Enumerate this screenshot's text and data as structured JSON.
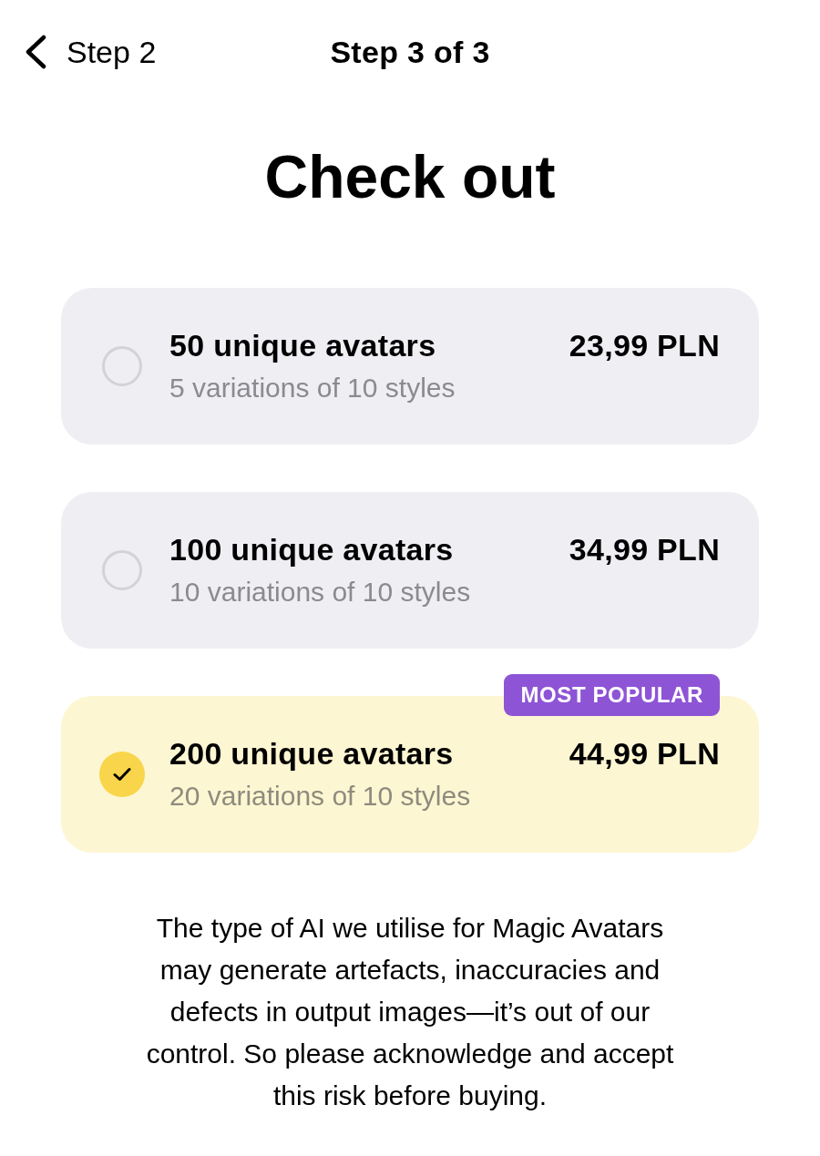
{
  "nav": {
    "back_label": "Step 2",
    "title": "Step 3 of 3"
  },
  "heading": "Check out",
  "plans": [
    {
      "title": "50 unique avatars",
      "subtitle": "5 variations of 10 styles",
      "price": "23,99 PLN",
      "selected": false
    },
    {
      "title": "100 unique avatars",
      "subtitle": "10 variations of 10 styles",
      "price": "34,99 PLN",
      "selected": false
    },
    {
      "title": "200 unique avatars",
      "subtitle": "20 variations of 10 styles",
      "price": "44,99 PLN",
      "badge": "MOST POPULAR",
      "selected": true
    }
  ],
  "disclaimer": "The type of AI we utilise for Magic Avatars may generate artefacts, inaccuracies and defects in output images—it’s out of our control. So please acknowledge and accept this risk before buying."
}
